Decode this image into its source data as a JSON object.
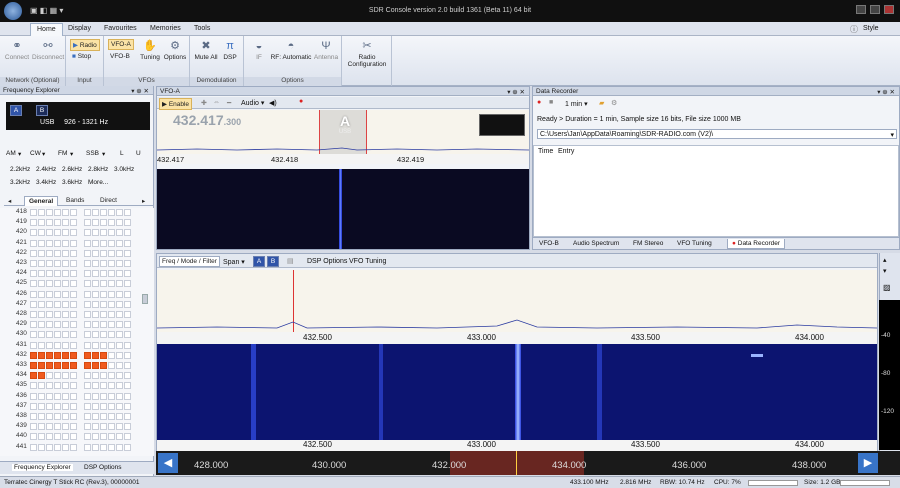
{
  "app": {
    "title": "SDR Console version 2.0 build 1361 (Beta 11) 64 bit",
    "style_label": "Style"
  },
  "ribbon_tabs": [
    "Home",
    "Display",
    "Favourites",
    "Memories",
    "Tools"
  ],
  "ribbon": {
    "network": {
      "connect": "Connect",
      "disconnect": "Disconnect",
      "label": "Network (Optional)"
    },
    "input": {
      "radio": "Radio",
      "stop": "Stop",
      "label": "Input"
    },
    "vfos": {
      "vfo_a": "VFO-A",
      "vfo_b": "VFO-B",
      "tuning": "Tuning",
      "options": "Options",
      "label": "VFOs"
    },
    "demod": {
      "mute_all": "Mute All",
      "dsp": "DSP",
      "label": "Demodulation"
    },
    "options": {
      "if": "IF",
      "rf": "RF: Automatic",
      "antenna": "Antenna",
      "label": "Options"
    },
    "radio_config": "Radio Configuration"
  },
  "freq_explorer": {
    "title": "Frequency Explorer",
    "lcd_a": "A",
    "lcd_b": "B",
    "lcd_info": "USB     926 - 1321 Hz",
    "modes": [
      "AM",
      "CW",
      "FM",
      "SSB",
      "L",
      "U"
    ],
    "bw_row1": [
      "2.2kHz",
      "2.4kHz",
      "2.6kHz",
      "2.8kHz",
      "3.0kHz"
    ],
    "bw_row2": [
      "3.2kHz",
      "3.4kHz",
      "3.6kHz",
      "More..."
    ],
    "tabs": [
      "General",
      "Bands",
      "Direct"
    ],
    "rows": [
      "418",
      "419",
      "420",
      "421",
      "422",
      "423",
      "424",
      "425",
      "426",
      "427",
      "428",
      "429",
      "430",
      "431",
      "432",
      "433",
      "434",
      "435",
      "436",
      "437",
      "438",
      "439",
      "440",
      "441"
    ],
    "bottom_tabs": [
      "Frequency Explorer",
      "DSP Options"
    ]
  },
  "vfo": {
    "title": "VFO-A",
    "enable": "Enable",
    "audio": "Audio",
    "freq_main": "432.417",
    "freq_sub": ".300",
    "badge": "A",
    "badge_sub": "USB",
    "axis": [
      "432.417",
      "432.418",
      "432.419"
    ]
  },
  "recorder": {
    "title": "Data Recorder",
    "duration": "1 min",
    "status": "Ready > Duration = 1 min, Sample size 16 bits, File size 1000 MB",
    "path": "C:\\Users\\Jan\\AppData\\Roaming\\SDR-RADIO.com (V2)\\",
    "col_time": "Time",
    "col_entry": "Entry",
    "tabs": [
      "VFO-B",
      "Audio Spectrum",
      "FM Stereo",
      "VFO Tuning",
      "Data Recorder"
    ]
  },
  "main": {
    "toolbar": [
      "Freq / Mode / Filter",
      "Span",
      "A",
      "B",
      "DSP Options",
      "VFO Tuning"
    ],
    "axis": [
      "432.500",
      "433.000",
      "433.500",
      "434.000"
    ]
  },
  "scale": [
    "-40",
    "-80",
    "-120"
  ],
  "nav_ticks": [
    "428.000",
    "430.000",
    "432.000",
    "434.000",
    "436.000",
    "438.000"
  ],
  "status": {
    "device": "Terratec Cinergy T Stick RC (Rev.3), 00000001",
    "center": "433.100 MHz",
    "rate": "2.816 MHz",
    "rbw": "RBW: 10.74 Hz",
    "cpu": "CPU: 7%",
    "size": "Size: 1.2 GB"
  },
  "colors": {
    "accent": "#3874c8",
    "memory_on": "#f05a1e",
    "waterfall": "#0c1470"
  }
}
